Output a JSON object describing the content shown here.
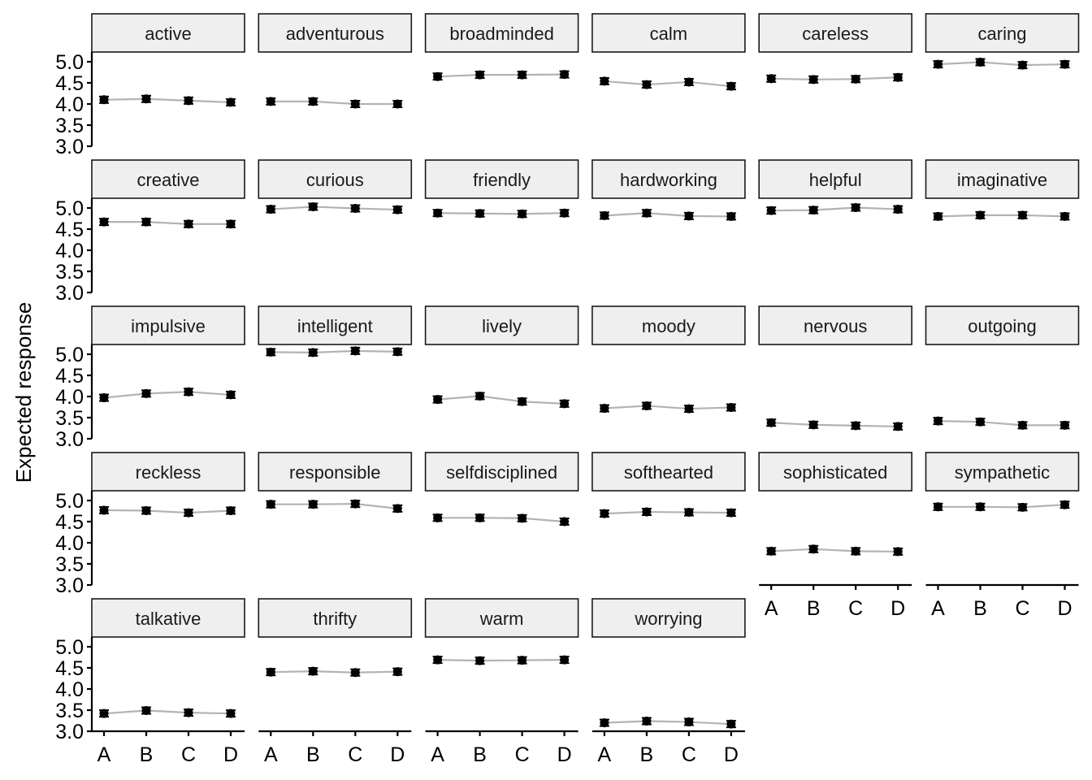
{
  "chart_data": {
    "type": "line",
    "title": "",
    "xlabel": "",
    "ylabel": "Expected response",
    "ylim": [
      3.0,
      5.0
    ],
    "yticks": [
      "3.0",
      "3.5",
      "4.0",
      "4.5",
      "5.0"
    ],
    "categories": [
      "A",
      "B",
      "C",
      "D"
    ],
    "grid": false,
    "facet_columns": 6,
    "point_color": "#000000",
    "line_color": "#b3b3b3",
    "strip_fill": "#efefef",
    "panels": [
      {
        "name": "active",
        "values": [
          4.1,
          4.12,
          4.08,
          4.04
        ]
      },
      {
        "name": "adventurous",
        "values": [
          4.06,
          4.06,
          4.0,
          4.0
        ]
      },
      {
        "name": "broadminded",
        "values": [
          4.65,
          4.69,
          4.69,
          4.7
        ]
      },
      {
        "name": "calm",
        "values": [
          4.54,
          4.46,
          4.52,
          4.42
        ]
      },
      {
        "name": "careless",
        "values": [
          4.6,
          4.58,
          4.59,
          4.63
        ]
      },
      {
        "name": "caring",
        "values": [
          4.94,
          4.99,
          4.92,
          4.94
        ]
      },
      {
        "name": "creative",
        "values": [
          4.67,
          4.67,
          4.62,
          4.62
        ]
      },
      {
        "name": "curious",
        "values": [
          4.97,
          5.03,
          4.99,
          4.96
        ]
      },
      {
        "name": "friendly",
        "values": [
          4.88,
          4.87,
          4.86,
          4.88
        ]
      },
      {
        "name": "hardworking",
        "values": [
          4.82,
          4.88,
          4.81,
          4.8
        ]
      },
      {
        "name": "helpful",
        "values": [
          4.94,
          4.95,
          5.01,
          4.97
        ]
      },
      {
        "name": "imaginative",
        "values": [
          4.8,
          4.83,
          4.83,
          4.8
        ]
      },
      {
        "name": "impulsive",
        "values": [
          3.97,
          4.07,
          4.11,
          4.04
        ]
      },
      {
        "name": "intelligent",
        "values": [
          5.05,
          5.04,
          5.08,
          5.06
        ]
      },
      {
        "name": "lively",
        "values": [
          3.93,
          4.01,
          3.88,
          3.83
        ]
      },
      {
        "name": "moody",
        "values": [
          3.72,
          3.78,
          3.71,
          3.74
        ]
      },
      {
        "name": "nervous",
        "values": [
          3.38,
          3.33,
          3.31,
          3.29
        ]
      },
      {
        "name": "outgoing",
        "values": [
          3.42,
          3.4,
          3.32,
          3.32
        ]
      },
      {
        "name": "reckless",
        "values": [
          4.77,
          4.76,
          4.71,
          4.76
        ]
      },
      {
        "name": "responsible",
        "values": [
          4.91,
          4.91,
          4.92,
          4.81
        ]
      },
      {
        "name": "selfdisciplined",
        "values": [
          4.59,
          4.59,
          4.58,
          4.5
        ]
      },
      {
        "name": "softhearted",
        "values": [
          4.69,
          4.73,
          4.72,
          4.71
        ]
      },
      {
        "name": "sophisticated",
        "values": [
          3.8,
          3.85,
          3.8,
          3.79
        ]
      },
      {
        "name": "sympathetic",
        "values": [
          4.85,
          4.85,
          4.84,
          4.9
        ]
      },
      {
        "name": "talkative",
        "values": [
          3.42,
          3.49,
          3.44,
          3.42
        ]
      },
      {
        "name": "thrifty",
        "values": [
          4.4,
          4.42,
          4.39,
          4.41
        ]
      },
      {
        "name": "warm",
        "values": [
          4.69,
          4.67,
          4.68,
          4.69
        ]
      },
      {
        "name": "worrying",
        "values": [
          3.2,
          3.24,
          3.22,
          3.17
        ]
      }
    ]
  }
}
